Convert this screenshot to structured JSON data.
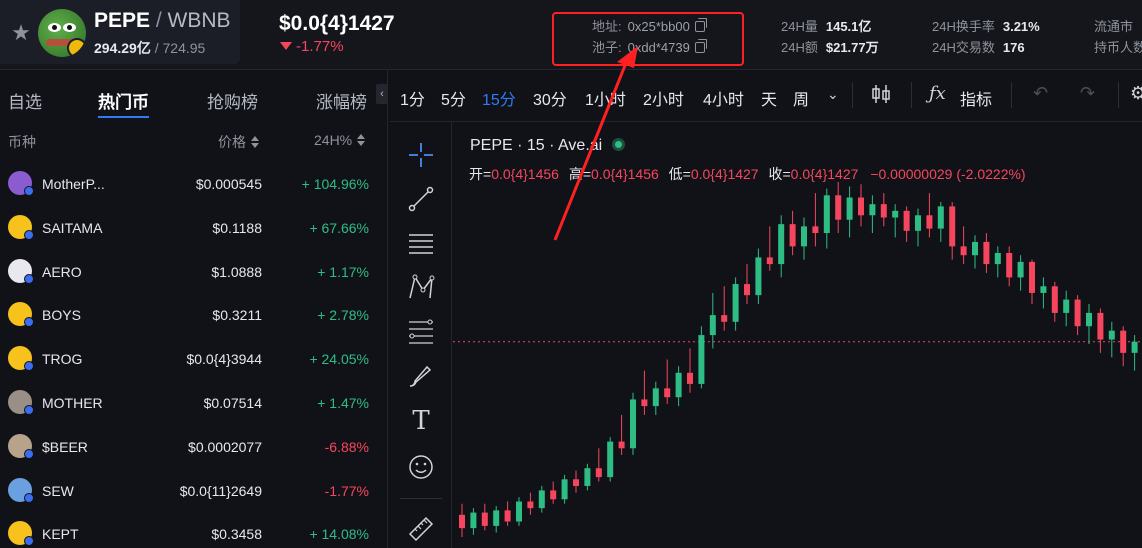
{
  "token": {
    "base": "PEPE",
    "quote": "WBNB",
    "market_cap": "294.29亿",
    "liquidity": "724.95",
    "price": "$0.0{4}1427",
    "change": "-1.77%"
  },
  "contract": {
    "address_label": "地址:",
    "address_value": "0x25*bb00",
    "pool_label": "池子:",
    "pool_value": "0xdd*4739"
  },
  "stats": {
    "vol_label": "24H量",
    "vol_value": "145.1亿",
    "amount_label": "24H额",
    "amount_value": "$21.77万",
    "turnover_label": "24H换手率",
    "turnover_value": "3.21%",
    "trades_label": "24H交易数",
    "trades_value": "176",
    "circ_label": "流通市",
    "holders_label": "持币人数"
  },
  "left_tabs": [
    "自选",
    "热门币",
    "抢购榜",
    "涨幅榜"
  ],
  "columns": {
    "coin": "币种",
    "price": "价格",
    "change": "24H%"
  },
  "coins": [
    {
      "symbol": "MotherP...",
      "price": "$0.000545",
      "change": "+ 104.96%",
      "dir": "up",
      "color": "#8a5cd0"
    },
    {
      "symbol": "SAITAMA",
      "price": "$0.1188",
      "change": "+ 67.66%",
      "dir": "up",
      "color": "#f7c21b"
    },
    {
      "symbol": "AERO",
      "price": "$1.0888",
      "change": "+ 1.17%",
      "dir": "up",
      "color": "#e8e8ee"
    },
    {
      "symbol": "BOYS",
      "price": "$0.3211",
      "change": "+ 2.78%",
      "dir": "up",
      "color": "#f7c21b"
    },
    {
      "symbol": "TROG",
      "price": "$0.0{4}3944",
      "change": "+ 24.05%",
      "dir": "up",
      "color": "#f7c21b"
    },
    {
      "symbol": "MOTHER",
      "price": "$0.07514",
      "change": "+ 1.47%",
      "dir": "up",
      "color": "#9a8f86"
    },
    {
      "symbol": "$BEER",
      "price": "$0.0002077",
      "change": "-6.88%",
      "dir": "down",
      "color": "#b7a38a"
    },
    {
      "symbol": "SEW",
      "price": "$0.0{11}2649",
      "change": "-1.77%",
      "dir": "down",
      "color": "#6aa0e0"
    },
    {
      "symbol": "KEPT",
      "price": "$0.3458",
      "change": "+ 14.08%",
      "dir": "up",
      "color": "#f7c21b"
    }
  ],
  "timeframes": [
    "1分",
    "5分",
    "15分",
    "30分",
    "1小时",
    "2小时",
    "4小时",
    "天",
    "周"
  ],
  "active_timeframe": "15分",
  "toolbar": {
    "indicators_label": "指标"
  },
  "chart": {
    "legend_title": "PEPE · 15 · Ave.ai",
    "open_label": "开=",
    "open_value": "0.0{4}1456",
    "high_label": "高=",
    "high_value": "0.0{4}1456",
    "low_label": "低=",
    "low_value": "0.0{4}1427",
    "close_label": "收=",
    "close_value": "0.0{4}1427",
    "delta": "−0.00000029 (-2.0222%)",
    "up_color": "#2ebd85",
    "down_color": "#f6465d"
  },
  "chart_data": {
    "type": "candlestick",
    "candles_ohlc": [
      [
        0.0155,
        0.016,
        0.0145,
        0.0149
      ],
      [
        0.0149,
        0.0158,
        0.0146,
        0.0156
      ],
      [
        0.0156,
        0.016,
        0.0148,
        0.015
      ],
      [
        0.015,
        0.0159,
        0.0147,
        0.0157
      ],
      [
        0.0157,
        0.0161,
        0.015,
        0.0152
      ],
      [
        0.0152,
        0.0163,
        0.015,
        0.0161
      ],
      [
        0.0161,
        0.0165,
        0.0155,
        0.0158
      ],
      [
        0.0158,
        0.0168,
        0.0156,
        0.0166
      ],
      [
        0.0166,
        0.017,
        0.016,
        0.0162
      ],
      [
        0.0162,
        0.0173,
        0.016,
        0.0171
      ],
      [
        0.0171,
        0.0175,
        0.0165,
        0.0168
      ],
      [
        0.0168,
        0.0178,
        0.0166,
        0.0176
      ],
      [
        0.0176,
        0.0185,
        0.017,
        0.0172
      ],
      [
        0.0172,
        0.019,
        0.017,
        0.0188
      ],
      [
        0.0188,
        0.02,
        0.0182,
        0.0185
      ],
      [
        0.0185,
        0.021,
        0.0182,
        0.0207
      ],
      [
        0.0207,
        0.022,
        0.02,
        0.0204
      ],
      [
        0.0204,
        0.0215,
        0.02,
        0.0212
      ],
      [
        0.0212,
        0.0225,
        0.0205,
        0.0208
      ],
      [
        0.0208,
        0.0222,
        0.0204,
        0.0219
      ],
      [
        0.0219,
        0.023,
        0.021,
        0.0214
      ],
      [
        0.0214,
        0.024,
        0.0212,
        0.0236
      ],
      [
        0.0236,
        0.0255,
        0.023,
        0.0245
      ],
      [
        0.0245,
        0.0258,
        0.0238,
        0.0242
      ],
      [
        0.0242,
        0.0262,
        0.0238,
        0.0259
      ],
      [
        0.0259,
        0.0268,
        0.025,
        0.0254
      ],
      [
        0.0254,
        0.0275,
        0.025,
        0.0271
      ],
      [
        0.0271,
        0.0285,
        0.0265,
        0.0268
      ],
      [
        0.0268,
        0.029,
        0.0262,
        0.0286
      ],
      [
        0.0286,
        0.0292,
        0.0272,
        0.0276
      ],
      [
        0.0276,
        0.0289,
        0.027,
        0.0285
      ],
      [
        0.0285,
        0.03,
        0.0276,
        0.0282
      ],
      [
        0.0282,
        0.0302,
        0.0275,
        0.0299
      ],
      [
        0.0299,
        0.0305,
        0.0282,
        0.0288
      ],
      [
        0.0288,
        0.0303,
        0.028,
        0.0298
      ],
      [
        0.0298,
        0.0304,
        0.0285,
        0.029
      ],
      [
        0.029,
        0.0299,
        0.0282,
        0.0295
      ],
      [
        0.0295,
        0.03,
        0.0285,
        0.0289
      ],
      [
        0.0289,
        0.0295,
        0.028,
        0.0292
      ],
      [
        0.0292,
        0.0294,
        0.0278,
        0.0283
      ],
      [
        0.0283,
        0.0293,
        0.0276,
        0.029
      ],
      [
        0.029,
        0.03,
        0.028,
        0.0284
      ],
      [
        0.0284,
        0.0296,
        0.0278,
        0.0294
      ],
      [
        0.0294,
        0.0296,
        0.027,
        0.0276
      ],
      [
        0.0276,
        0.0285,
        0.0268,
        0.0272
      ],
      [
        0.0272,
        0.0281,
        0.0266,
        0.0278
      ],
      [
        0.0278,
        0.0282,
        0.0264,
        0.0268
      ],
      [
        0.0268,
        0.0276,
        0.0262,
        0.0273
      ],
      [
        0.0273,
        0.0276,
        0.0258,
        0.0262
      ],
      [
        0.0262,
        0.0272,
        0.0256,
        0.0269
      ],
      [
        0.0269,
        0.027,
        0.025,
        0.0255
      ],
      [
        0.0255,
        0.0262,
        0.0248,
        0.0258
      ],
      [
        0.0258,
        0.026,
        0.0242,
        0.0246
      ],
      [
        0.0246,
        0.0256,
        0.024,
        0.0252
      ],
      [
        0.0252,
        0.0254,
        0.0236,
        0.024
      ],
      [
        0.024,
        0.025,
        0.0232,
        0.0246
      ],
      [
        0.0246,
        0.0248,
        0.0228,
        0.0234
      ],
      [
        0.0234,
        0.0242,
        0.0226,
        0.0238
      ],
      [
        0.0238,
        0.024,
        0.0222,
        0.0228
      ],
      [
        0.0228,
        0.0236,
        0.022,
        0.0233
      ]
    ]
  }
}
